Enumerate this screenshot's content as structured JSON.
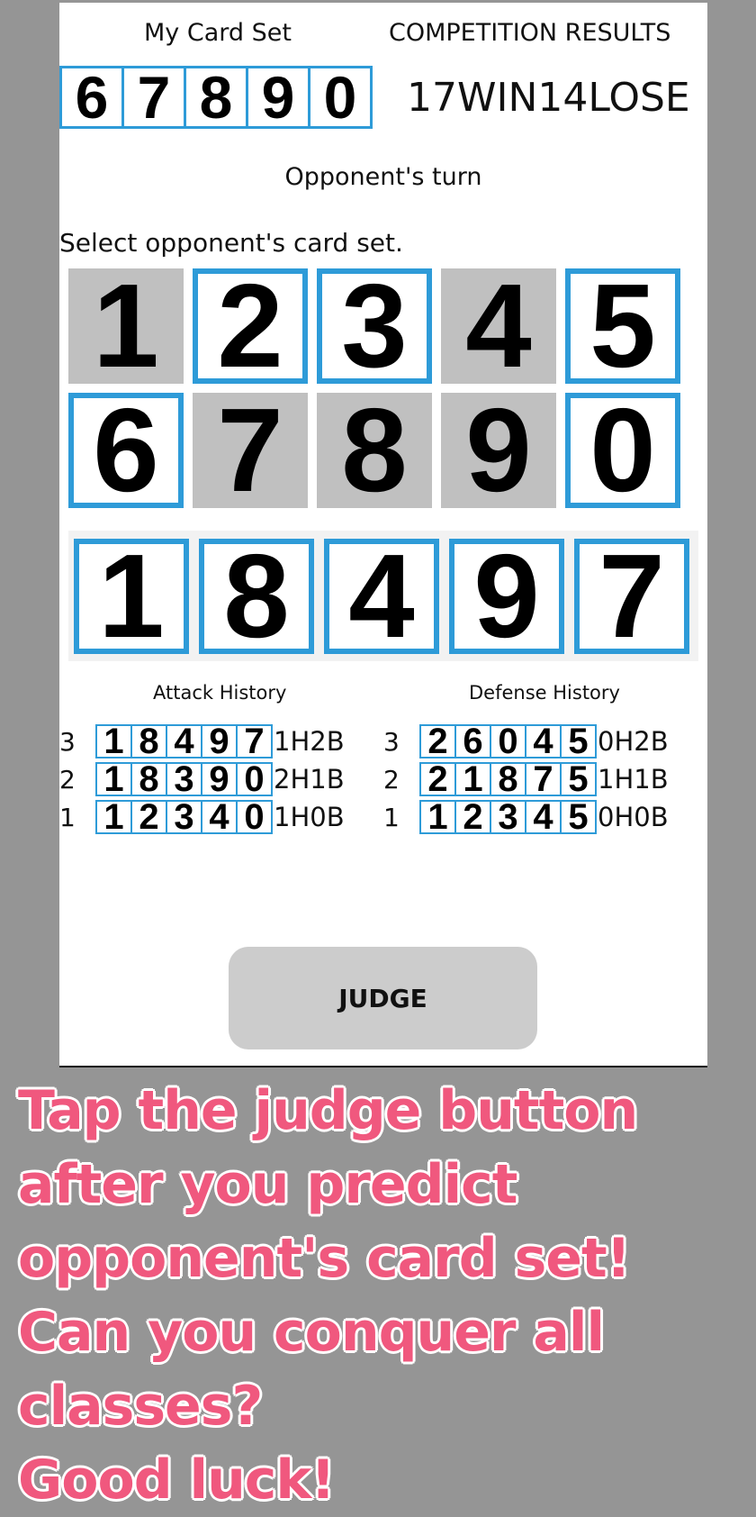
{
  "header": {
    "my_card_set_label": "My Card Set",
    "my_card_set": [
      "6",
      "7",
      "8",
      "9",
      "0"
    ],
    "results_label": "COMPETITION RESULTS",
    "record": "17WIN14LOSE"
  },
  "status": {
    "turn": "Opponent's turn",
    "prompt": "Select opponent's card set."
  },
  "card_grid": [
    {
      "digit": "1",
      "selected": false
    },
    {
      "digit": "2",
      "selected": true
    },
    {
      "digit": "3",
      "selected": true
    },
    {
      "digit": "4",
      "selected": false
    },
    {
      "digit": "5",
      "selected": true
    },
    {
      "digit": "6",
      "selected": true
    },
    {
      "digit": "7",
      "selected": false
    },
    {
      "digit": "8",
      "selected": false
    },
    {
      "digit": "9",
      "selected": false
    },
    {
      "digit": "0",
      "selected": true
    }
  ],
  "selected_set": [
    "1",
    "8",
    "4",
    "9",
    "7"
  ],
  "attack_history": {
    "title": "Attack History",
    "rows": [
      {
        "turn": "3",
        "digits": [
          "1",
          "8",
          "4",
          "9",
          "7"
        ],
        "result": "1H2B"
      },
      {
        "turn": "2",
        "digits": [
          "1",
          "8",
          "3",
          "9",
          "0"
        ],
        "result": "2H1B"
      },
      {
        "turn": "1",
        "digits": [
          "1",
          "2",
          "3",
          "4",
          "0"
        ],
        "result": "1H0B"
      }
    ]
  },
  "defense_history": {
    "title": "Defense History",
    "rows": [
      {
        "turn": "3",
        "digits": [
          "2",
          "6",
          "0",
          "4",
          "5"
        ],
        "result": "0H2B"
      },
      {
        "turn": "2",
        "digits": [
          "2",
          "1",
          "8",
          "7",
          "5"
        ],
        "result": "1H1B"
      },
      {
        "turn": "1",
        "digits": [
          "1",
          "2",
          "3",
          "4",
          "5"
        ],
        "result": "0H0B"
      }
    ]
  },
  "judge_button": "JUDGE",
  "promo_lines": [
    "Tap the judge button",
    "after you predict",
    "opponent's card set!",
    "Can you conquer all",
    "classes?",
    "Good luck!"
  ],
  "colors": {
    "card_border": "#2e9bd8",
    "card_disabled": "#c0c0c0",
    "promo_text": "#f0587e",
    "background": "#959595"
  }
}
